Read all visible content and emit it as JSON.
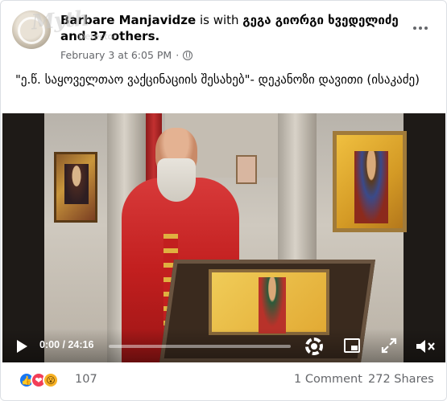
{
  "header": {
    "author": "Barbare Manjavidze",
    "with_text": " is with ",
    "tagged_names": "გეგა გიორგი ხვედელიძე and 37 others.",
    "timestamp": "February 3 at 6:05 PM",
    "separator": "·",
    "privacy_icon": "globe-icon",
    "more_icon": "more-options-icon"
  },
  "watermark": {
    "main": "Myth",
    "sub": "Detector"
  },
  "post": {
    "text": "\"ე.წ. საყოველთაო ვაქცინაციის შესახებ\"- დეკანოზი დავითი (ისაკაძე)"
  },
  "video": {
    "time": "0:00 / 24:16",
    "progress": 0.0,
    "icons": [
      "play-icon",
      "settings-gear-icon",
      "pip-icon",
      "fullscreen-icon",
      "volume-muted-icon"
    ]
  },
  "footer": {
    "reaction_count": "107",
    "comments": "1 Comment",
    "shares": "272 Shares",
    "reactions": [
      "like-icon",
      "love-icon",
      "wow-icon"
    ]
  },
  "colors": {
    "text": "#050505",
    "muted": "#65676b",
    "like": "#1877f2",
    "love": "#f33e58",
    "wow": "#f7b125"
  }
}
